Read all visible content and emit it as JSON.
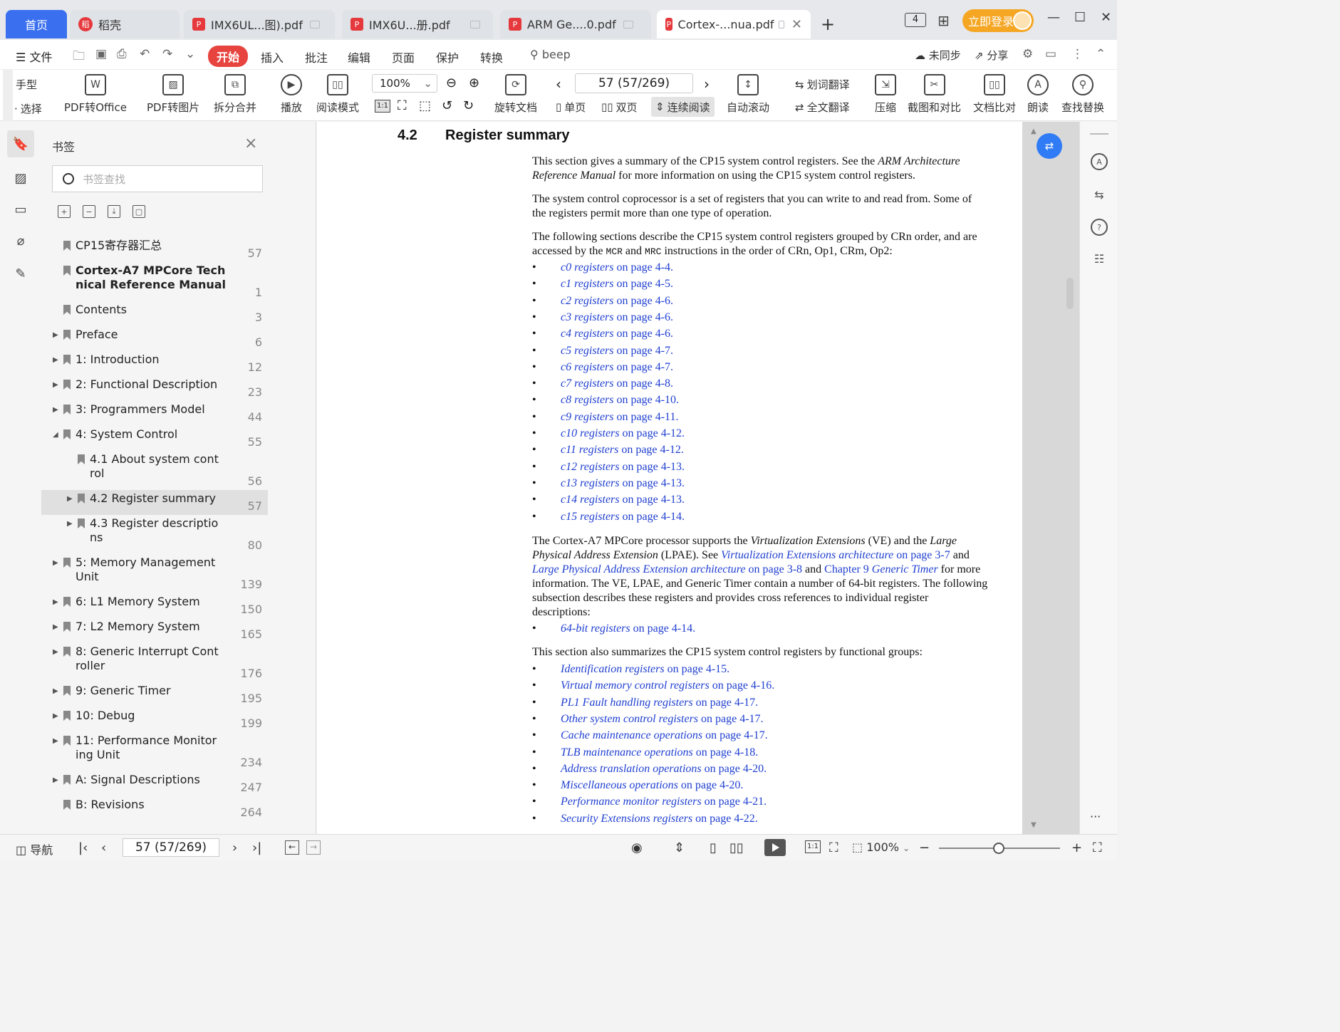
{
  "tabs": {
    "home": "首页",
    "items": [
      {
        "label": "稻壳",
        "icon": "daoke-icon"
      },
      {
        "label": "IMX6UL...图).pdf",
        "icon": "pdf-icon"
      },
      {
        "label": "IMX6U...册.pdf",
        "icon": "pdf-icon"
      },
      {
        "label": "ARM Ge....0.pdf",
        "icon": "pdf-icon"
      },
      {
        "label": "Cortex-...nua.pdf",
        "icon": "pdf-icon",
        "active": true
      }
    ],
    "new_tab": "+",
    "badge": "4",
    "login": "立即登录"
  },
  "menubar": {
    "file": "文件",
    "items": [
      "开始",
      "插入",
      "批注",
      "编辑",
      "页面",
      "保护",
      "转换"
    ],
    "active": "开始",
    "search": "beep",
    "sync": "未同步",
    "share": "分享"
  },
  "toolbar": {
    "hand": "手型",
    "select": "选择",
    "pdf_to_office": "PDF转Office",
    "pdf_to_image": "PDF转图片",
    "split_merge": "拆分合并",
    "play": "播放",
    "read_mode": "阅读模式",
    "zoom": "100%",
    "rotate": "旋转文档",
    "page_display": "57 (57/269)",
    "single": "单页",
    "double": "双页",
    "continuous": "连续阅读",
    "auto_scroll": "自动滚动",
    "word_translate": "划词翻译",
    "full_translate": "全文翻译",
    "compress": "压缩",
    "screenshot_compare": "截图和对比",
    "doc_compare": "文档比对",
    "read_aloud": "朗读",
    "find_replace": "查找替换"
  },
  "bookmarks": {
    "title": "书签",
    "search_placeholder": "书签查找",
    "items": [
      {
        "l1": "CP15寄存器汇总",
        "l2": "",
        "page": "57",
        "bold": false,
        "arrow": "",
        "level": 0
      },
      {
        "l1": "Cortex-A7 MPCore Tech",
        "l2": "nical Reference Manual",
        "page": "1",
        "bold": true,
        "arrow": "",
        "level": 0
      },
      {
        "l1": "Contents",
        "l2": "",
        "page": "3",
        "bold": false,
        "arrow": "",
        "level": 0
      },
      {
        "l1": "Preface",
        "l2": "",
        "page": "6",
        "bold": false,
        "arrow": "▶",
        "level": 0
      },
      {
        "l1": "1: Introduction",
        "l2": "",
        "page": "12",
        "bold": false,
        "arrow": "▶",
        "level": 0
      },
      {
        "l1": "2: Functional Description",
        "l2": "",
        "page": "23",
        "bold": false,
        "arrow": "▶",
        "level": 0
      },
      {
        "l1": "3: Programmers Model",
        "l2": "",
        "page": "44",
        "bold": false,
        "arrow": "▶",
        "level": 0
      },
      {
        "l1": "4: System Control",
        "l2": "",
        "page": "55",
        "bold": false,
        "arrow": "◢",
        "level": 0
      },
      {
        "l1": "4.1 About system cont",
        "l2": "rol",
        "page": "56",
        "bold": false,
        "arrow": "",
        "level": 1
      },
      {
        "l1": "4.2 Register summary",
        "l2": "",
        "page": "57",
        "bold": false,
        "arrow": "▶",
        "level": 1,
        "selected": true
      },
      {
        "l1": "4.3 Register descriptio",
        "l2": "ns",
        "page": "80",
        "bold": false,
        "arrow": "▶",
        "level": 1
      },
      {
        "l1": "5: Memory Management",
        "l2": "Unit",
        "page": "139",
        "bold": false,
        "arrow": "▶",
        "level": 0
      },
      {
        "l1": "6: L1 Memory System",
        "l2": "",
        "page": "150",
        "bold": false,
        "arrow": "▶",
        "level": 0
      },
      {
        "l1": "7: L2 Memory System",
        "l2": "",
        "page": "165",
        "bold": false,
        "arrow": "▶",
        "level": 0
      },
      {
        "l1": "8: Generic Interrupt Cont",
        "l2": "roller",
        "page": "176",
        "bold": false,
        "arrow": "▶",
        "level": 0
      },
      {
        "l1": "9: Generic Timer",
        "l2": "",
        "page": "195",
        "bold": false,
        "arrow": "▶",
        "level": 0
      },
      {
        "l1": "10: Debug",
        "l2": "",
        "page": "199",
        "bold": false,
        "arrow": "▶",
        "level": 0
      },
      {
        "l1": "11: Performance Monitor",
        "l2": "ing Unit",
        "page": "234",
        "bold": false,
        "arrow": "▶",
        "level": 0
      },
      {
        "l1": "A: Signal Descriptions",
        "l2": "",
        "page": "247",
        "bold": false,
        "arrow": "▶",
        "level": 0
      },
      {
        "l1": "B: Revisions",
        "l2": "",
        "page": "264",
        "bold": false,
        "arrow": "",
        "level": 0
      }
    ]
  },
  "document": {
    "section_number": "4.2",
    "section_title": "Register summary",
    "p1a": "This section gives a summary of the CP15 system control registers. See the ",
    "p1_ref": "ARM Architecture Reference Manual",
    "p1b": " for more information on using the CP15 system control registers.",
    "p2": "The system control coprocessor is a set of registers that you can write to and read from. Some of the registers permit more than one type of operation.",
    "p3a": "The following sections describe the CP15 system control registers grouped by CRn order, and are accessed by the ",
    "p3_mcr": "MCR",
    "p3_and": " and ",
    "p3_mrc": "MRC",
    "p3b": " instructions in the order of CRn, Op1, CRm, Op2:",
    "crn_list": [
      {
        "name": "c0 registers",
        "page": " on page 4-4."
      },
      {
        "name": "c1 registers",
        "page": " on page 4-5."
      },
      {
        "name": "c2 registers",
        "page": " on page 4-6."
      },
      {
        "name": "c3 registers",
        "page": " on page 4-6."
      },
      {
        "name": "c4 registers",
        "page": " on page 4-6."
      },
      {
        "name": "c5 registers",
        "page": " on page 4-7."
      },
      {
        "name": "c6 registers",
        "page": " on page 4-7."
      },
      {
        "name": "c7 registers",
        "page": " on page 4-8."
      },
      {
        "name": "c8 registers",
        "page": " on page 4-10."
      },
      {
        "name": "c9 registers",
        "page": " on page 4-11."
      },
      {
        "name": "c10 registers",
        "page": " on page 4-12."
      },
      {
        "name": "c11 registers",
        "page": " on page 4-12."
      },
      {
        "name": "c12 registers",
        "page": " on page 4-13."
      },
      {
        "name": "c13 registers",
        "page": " on page 4-13."
      },
      {
        "name": "c14 registers",
        "page": " on page 4-13."
      },
      {
        "name": "c15 registers",
        "page": " on page 4-14."
      }
    ],
    "p4": {
      "t1": "The Cortex-A7 MPCore processor supports the ",
      "ve": "Virtualization Extensions",
      "t2": " (VE) and the ",
      "lpae": "Large Physical Address Extension",
      "t3": " (LPAE). See ",
      "ref1": "Virtualization Extensions architecture",
      "ref1p": " on page 3-7",
      "t4": " and ",
      "ref2": "Large Physical Address Extension architecture",
      "ref2p": " on page 3-8",
      "t5": " and ",
      "ref3a": "Chapter 9 ",
      "ref3b": "Generic Timer",
      "t6": " for more information. The VE, LPAE, and Generic Timer contain a number of 64-bit registers. The following subsection describes these registers and provides cross references to individual register descriptions:"
    },
    "bit64": {
      "name": "64-bit registers",
      "page": " on page 4-14."
    },
    "p5": "This section also summarizes the CP15 system control registers by functional groups:",
    "func_list": [
      {
        "name": "Identification registers",
        "page": " on page 4-15."
      },
      {
        "name": "Virtual memory control registers",
        "page": " on page 4-16."
      },
      {
        "name": "PL1 Fault handling registers",
        "page": " on page 4-17."
      },
      {
        "name": "Other system control registers",
        "page": " on page 4-17."
      },
      {
        "name": "Cache maintenance operations",
        "page": " on page 4-17."
      },
      {
        "name": "TLB maintenance operations",
        "page": " on page 4-18."
      },
      {
        "name": "Address translation operations",
        "page": " on page 4-20."
      },
      {
        "name": "Miscellaneous operations",
        "page": " on page 4-20."
      },
      {
        "name": "Performance monitor registers",
        "page": " on page 4-21."
      },
      {
        "name": "Security Extensions registers",
        "page": " on page 4-22."
      }
    ]
  },
  "statusbar": {
    "nav": "导航",
    "page_display": "57 (57/269)",
    "zoom": "100%"
  },
  "colors": {
    "accent": "#3a6ff0",
    "active_menu": "#e8443f",
    "link": "#1f3fd0",
    "login": "#f5a623"
  }
}
